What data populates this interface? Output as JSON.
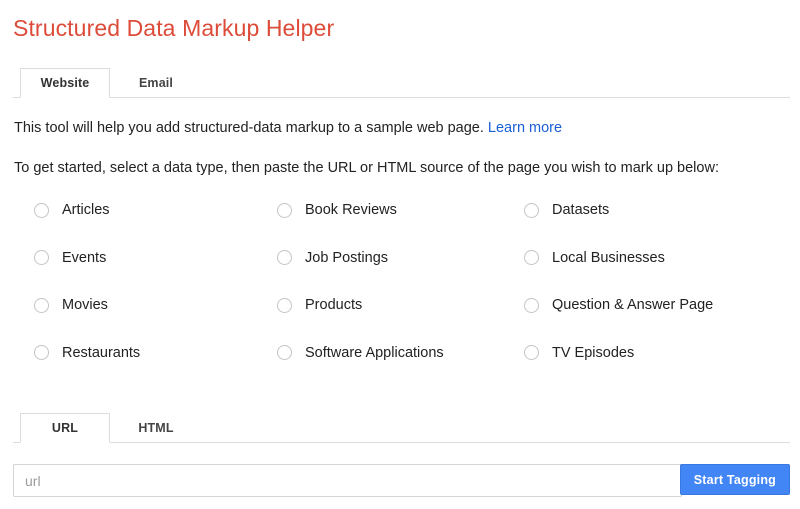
{
  "header": {
    "title": "Structured Data Markup Helper",
    "title_color": "#dd4b39"
  },
  "source_tabs": {
    "items": [
      {
        "label": "Website",
        "active": true
      },
      {
        "label": "Email",
        "active": false
      }
    ]
  },
  "intro": {
    "text": "This tool will help you add structured-data markup to a sample web page.",
    "link_label": "Learn more",
    "link_color": "#1a5fd6"
  },
  "instruction": {
    "text": "To get started, select a data type, then paste the URL or HTML source of the page you wish to mark up below:"
  },
  "data_types": {
    "rows": [
      [
        {
          "label": "Articles",
          "selected": false
        },
        {
          "label": "Book Reviews",
          "selected": false
        },
        {
          "label": "Datasets",
          "selected": false
        }
      ],
      [
        {
          "label": "Events",
          "selected": false
        },
        {
          "label": "Job Postings",
          "selected": false
        },
        {
          "label": "Local Businesses",
          "selected": false
        }
      ],
      [
        {
          "label": "Movies",
          "selected": false
        },
        {
          "label": "Products",
          "selected": false
        },
        {
          "label": "Question & Answer Page",
          "selected": false
        }
      ],
      [
        {
          "label": "Restaurants",
          "selected": false
        },
        {
          "label": "Software Applications",
          "selected": false
        },
        {
          "label": "TV Episodes",
          "selected": false
        }
      ]
    ]
  },
  "input_tabs": {
    "items": [
      {
        "label": "URL",
        "active": true
      },
      {
        "label": "HTML",
        "active": false
      }
    ]
  },
  "input_row": {
    "url_value": "",
    "url_placeholder": "url",
    "submit_label": "Start Tagging",
    "submit_color": "#4285f4"
  }
}
